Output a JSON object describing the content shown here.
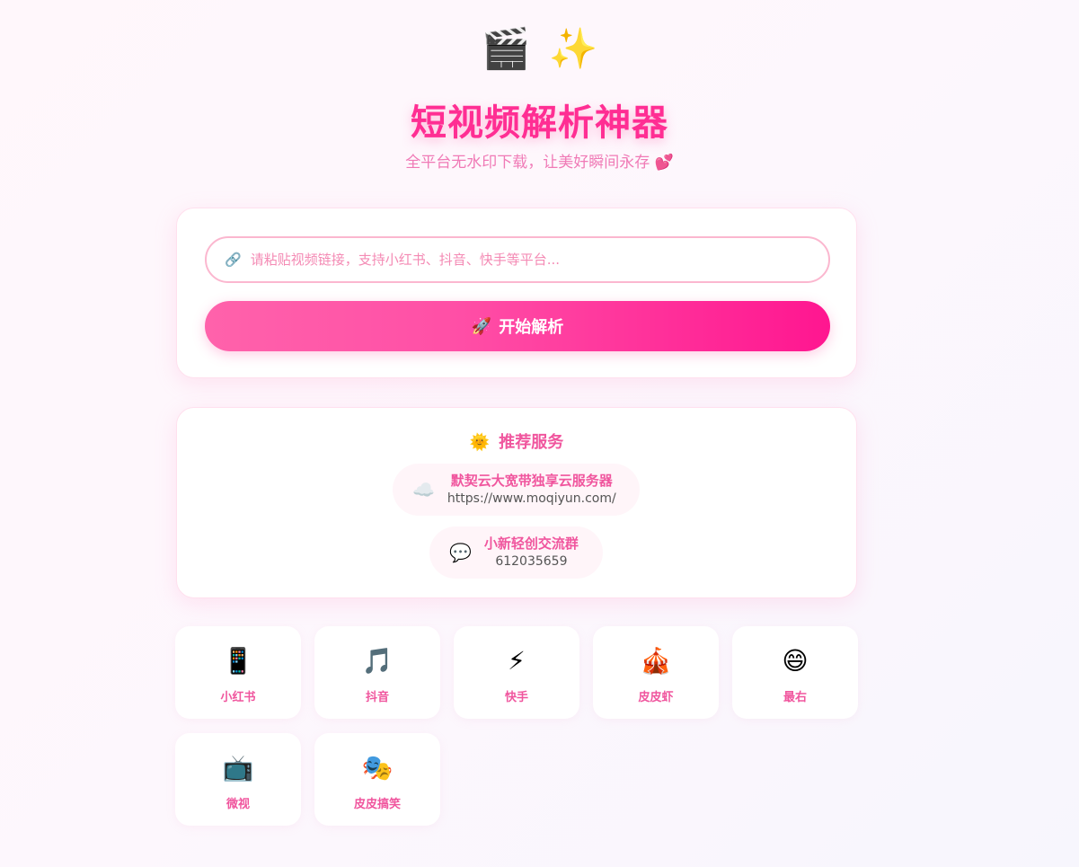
{
  "header": {
    "icons": [
      {
        "name": "clapperboard-icon",
        "glyph": "🎬"
      },
      {
        "name": "sparkles-icon",
        "glyph": "✨"
      }
    ],
    "title": "短视频解析神器",
    "subtitle": "全平台无水印下载，让美好瞬间永存 💕"
  },
  "search": {
    "link_icon": "🔗",
    "placeholder": "请粘贴视频链接，支持小红书、抖音、快手等平台...",
    "value": "",
    "button_icon": "🚀",
    "button_label": "开始解析"
  },
  "recommend": {
    "icon": "🌞",
    "title": "推荐服务",
    "items": [
      {
        "icon": "☁️",
        "name": "默契云大宽带独享云服务器",
        "detail": "https://www.moqiyun.com/"
      },
      {
        "icon": "💬",
        "name": "小新轻创交流群",
        "detail": "612035659"
      }
    ]
  },
  "platforms": [
    {
      "icon": "📱",
      "label": "小红书"
    },
    {
      "icon": "🎵",
      "label": "抖音"
    },
    {
      "icon": "⚡",
      "label": "快手"
    },
    {
      "icon": "🎪",
      "label": "皮皮虾"
    },
    {
      "icon": "😄",
      "label": "最右"
    },
    {
      "icon": "📺",
      "label": "微视"
    },
    {
      "icon": "🎭",
      "label": "皮皮搞笑"
    }
  ],
  "colors": {
    "accent": "#ff2e93",
    "accent_light": "#f0569e",
    "input_border": "#fbb7cf"
  }
}
